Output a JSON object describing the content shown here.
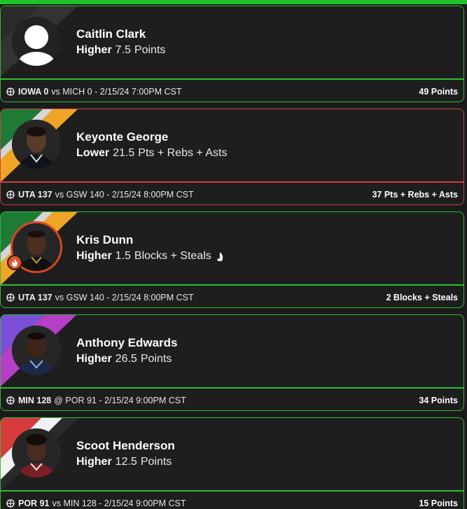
{
  "colors": {
    "accent_green": "#2ebd35",
    "loss_red": "#c9443e",
    "background": "#1b1b1b",
    "card": "#1e1e1e"
  },
  "picks": [
    {
      "player": "Caitlin Clark",
      "direction": "Higher",
      "line": "7.5",
      "stat": "Points",
      "has_fire": false,
      "home_team_score": "IOWA 0",
      "matchup_rest": "vs MICH 0 - 2/15/24 7:00PM CST",
      "result": "49 Points",
      "status": "win",
      "avatar": "placeholder-avatar-icon"
    },
    {
      "player": "Keyonte George",
      "direction": "Lower",
      "line": "21.5",
      "stat": "Pts + Rebs + Asts",
      "has_fire": false,
      "home_team_score": "UTA 137",
      "matchup_rest": "vs GSW 140 - 2/15/24 8:00PM CST",
      "result": "37 Pts + Rebs + Asts",
      "status": "loss",
      "avatar": "player-photo"
    },
    {
      "player": "Kris Dunn",
      "direction": "Higher",
      "line": "1.5",
      "stat": "Blocks + Steals",
      "has_fire": true,
      "home_team_score": "UTA 137",
      "matchup_rest": "vs GSW 140 - 2/15/24 8:00PM CST",
      "result": "2 Blocks + Steals",
      "status": "win",
      "avatar": "player-photo"
    },
    {
      "player": "Anthony Edwards",
      "direction": "Higher",
      "line": "26.5",
      "stat": "Points",
      "has_fire": false,
      "home_team_score": "MIN 128",
      "matchup_rest": "@ POR 91 - 2/15/24 9:00PM CST",
      "result": "34 Points",
      "status": "win",
      "avatar": "player-photo"
    },
    {
      "player": "Scoot Henderson",
      "direction": "Higher",
      "line": "12.5",
      "stat": "Points",
      "has_fire": false,
      "home_team_score": "POR 91",
      "matchup_rest": "vs MIN 128 - 2/15/24 9:00PM CST",
      "result": "15 Points",
      "status": "win",
      "avatar": "player-photo"
    }
  ]
}
